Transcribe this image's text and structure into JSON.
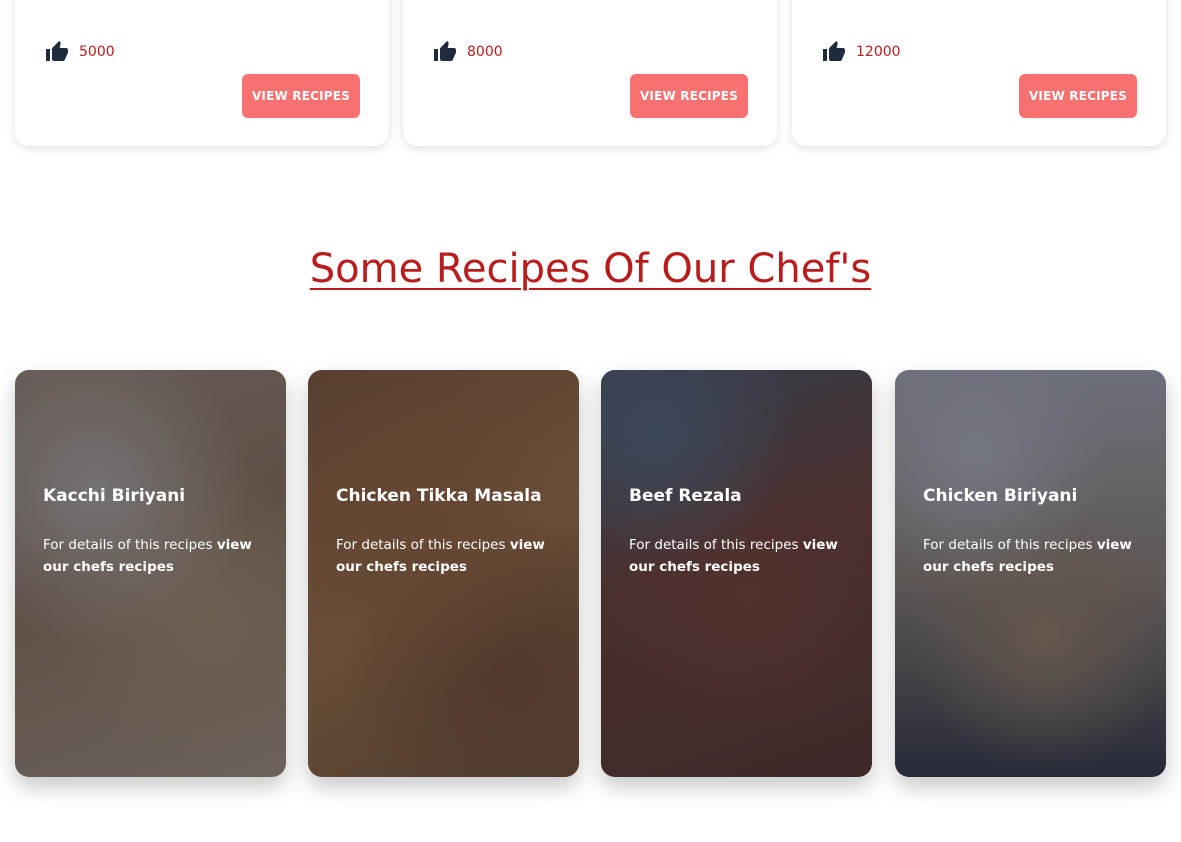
{
  "chef_cards": [
    {
      "likes": "5000",
      "button_label": "VIEW RECIPES"
    },
    {
      "likes": "8000",
      "button_label": "VIEW RECIPES"
    },
    {
      "likes": "12000",
      "button_label": "VIEW RECIPES"
    }
  ],
  "section": {
    "title": "Some Recipes Of Our Chef's"
  },
  "recipes": [
    {
      "name": "Kacchi Biriyani",
      "desc_prefix": "For details of this recipes ",
      "desc_link": "view our chefs recipes"
    },
    {
      "name": "Chicken Tikka Masala",
      "desc_prefix": "For details of this recipes ",
      "desc_link": "view our chefs recipes"
    },
    {
      "name": "Beef Rezala",
      "desc_prefix": "For details of this recipes ",
      "desc_link": "view our chefs recipes"
    },
    {
      "name": "Chicken Biriyani",
      "desc_prefix": "For details of this recipes ",
      "desc_link": "view our chefs recipes"
    }
  ],
  "colors": {
    "accent": "#b91c1c",
    "button": "#f87171",
    "icon": "#1f2a3c"
  },
  "icons": {
    "likes": "thumbs-up-icon"
  }
}
